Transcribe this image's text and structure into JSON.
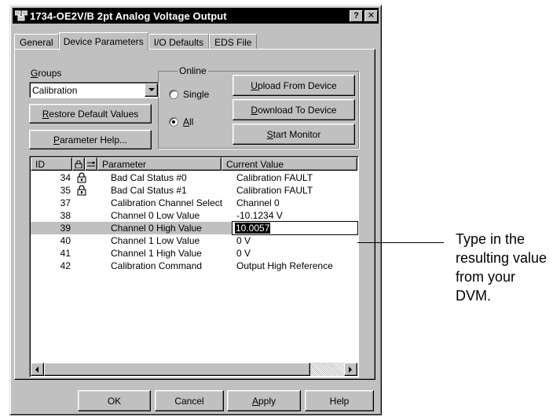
{
  "window": {
    "title": "1734-OE2V/B 2pt Analog Voltage Output",
    "help_btn": "?",
    "close_btn": "✕"
  },
  "tabs": [
    {
      "label": "General",
      "active": false
    },
    {
      "label": "Device Parameters",
      "active": true
    },
    {
      "label": "I/O Defaults",
      "active": false
    },
    {
      "label": "EDS File",
      "active": false
    }
  ],
  "groups": {
    "label_prefix": "G",
    "label_rest": "roups",
    "selected": "Calibration"
  },
  "buttons": {
    "restore_u": "R",
    "restore_rest": "estore Default Values",
    "param_help_u": "P",
    "param_help_rest": "arameter Help...",
    "upload_u": "U",
    "upload_rest": "pload From Device",
    "download_u": "D",
    "download_rest": "ownload To Device",
    "monitor_u": "S",
    "monitor_rest": "tart Monitor"
  },
  "online": {
    "label": "Online",
    "single_label": "Single",
    "all_u": "A",
    "all_rest": "ll",
    "selected": "All"
  },
  "table": {
    "headers": {
      "id": "ID",
      "parameter": "Parameter",
      "value": "Current Value"
    },
    "rows": [
      {
        "id": "34",
        "locked": true,
        "parameter": "Bad Cal Status #0",
        "value": "Calibration FAULT"
      },
      {
        "id": "35",
        "locked": true,
        "parameter": "Bad Cal Status #1",
        "value": "Calibration FAULT"
      },
      {
        "id": "37",
        "locked": false,
        "parameter": "Calibration Channel Select",
        "value": "Channel 0"
      },
      {
        "id": "38",
        "locked": false,
        "parameter": "Channel 0 Low Value",
        "value": "-10.1234 V"
      },
      {
        "id": "39",
        "locked": false,
        "parameter": "Channel 0 High Value",
        "value": "10.0057",
        "editing": true
      },
      {
        "id": "40",
        "locked": false,
        "parameter": "Channel 1 Low Value",
        "value": "0 V"
      },
      {
        "id": "41",
        "locked": false,
        "parameter": "Channel 1 High Value",
        "value": "0 V"
      },
      {
        "id": "42",
        "locked": false,
        "parameter": "Calibration Command",
        "value": "Output High Reference"
      }
    ]
  },
  "footer": {
    "ok": "OK",
    "cancel": "Cancel",
    "apply_u": "A",
    "apply_rest": "pply",
    "help": "Help"
  },
  "callout": {
    "lines": [
      "Type in the",
      "resulting value",
      "from your",
      "DVM."
    ]
  }
}
